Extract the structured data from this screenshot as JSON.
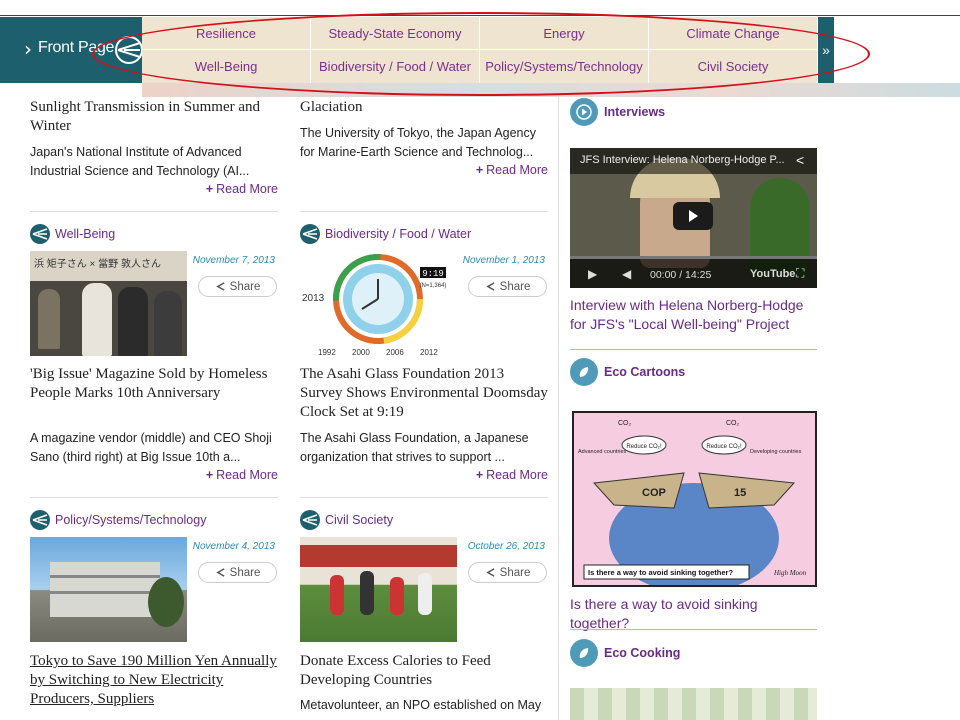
{
  "nav": {
    "front_page": "Front Page",
    "more": "»",
    "categories_row1": [
      "Resilience",
      "Steady-State Economy",
      "Energy",
      "Climate Change"
    ],
    "categories_row2": [
      "Well-Being",
      "Biodiversity / Food / Water",
      "Policy/Systems/Technology",
      "Civil Society"
    ]
  },
  "articles": {
    "a1": {
      "title": "Sunlight Transmission in Summer and Winter",
      "excerpt": "Japan's National Institute of Advanced Industrial Science and Technology (AI...",
      "read_more": "Read More"
    },
    "a2": {
      "title": "Glaciation",
      "excerpt": "The University of Tokyo, the Japan Agency for Marine-Earth Science and Technolog...",
      "read_more": "Read More"
    },
    "a3": {
      "category": "Well-Being",
      "date": "November 7, 2013",
      "share": "Share",
      "title": "'Big Issue' Magazine Sold by Homeless People Marks 10th Anniversary",
      "excerpt": "A magazine vendor (middle) and CEO Shoji Sano (third right) at Big Issue 10th a...",
      "read_more": "Read More"
    },
    "a4": {
      "category": "Biodiversity / Food / Water",
      "date": "November 1, 2013",
      "share": "Share",
      "title": "The Asahi Glass Foundation 2013 Survey Shows Environmental Doomsday Clock Set at 9:19",
      "excerpt": "The Asahi Glass Foundation, a Japanese organization that strives to support ...",
      "read_more": "Read More"
    },
    "a5": {
      "category": "Policy/Systems/Technology",
      "date": "November 4, 2013",
      "share": "Share",
      "title": "Tokyo to Save 190 Million Yen Annually by Switching to New Electricity Producers, Suppliers"
    },
    "a6": {
      "category": "Civil Society",
      "date": "October 26, 2013",
      "share": "Share",
      "title": "Donate Excess Calories to Feed Developing Countries",
      "excerpt": "Metavolunteer, an NPO established on May"
    }
  },
  "sidebar": {
    "interviews": {
      "heading": "Interviews",
      "video_title": "JFS Interview: Helena Norberg-Hodge P...",
      "time": "00:00 / 14:25",
      "youtube": "YouTube",
      "link": "Interview with Helena Norberg-Hodge for JFS's \"Local Well-being\" Project"
    },
    "cartoons": {
      "heading": "Eco Cartoons",
      "caption": "Is there a way to avoid sinking together?",
      "link": "Is there a way to avoid sinking together?",
      "co2": "CO₂",
      "bubble_left": "Reduce CO₂!",
      "bubble_right": "Reduce CO₂!",
      "label_left": "Advanced countries",
      "label_right": "Developing countries",
      "boat_left": "COP",
      "boat_right": "15",
      "signature": "High Moon"
    },
    "cooking": {
      "heading": "Eco Cooking"
    }
  },
  "images": {
    "bigissue_sign": "浜 矩子さん × 當野 敦人さん",
    "clock_years": [
      "1992",
      "2000",
      "2006",
      "2012"
    ],
    "clock_year": "2013",
    "clock_time": "9:19",
    "clock_n": "(N=1,364)"
  },
  "colors": {
    "teal": "#1d5f6c",
    "purple": "#6a2a86",
    "date_blue": "#2a8ab5",
    "annotation_red": "#d40f1a"
  }
}
